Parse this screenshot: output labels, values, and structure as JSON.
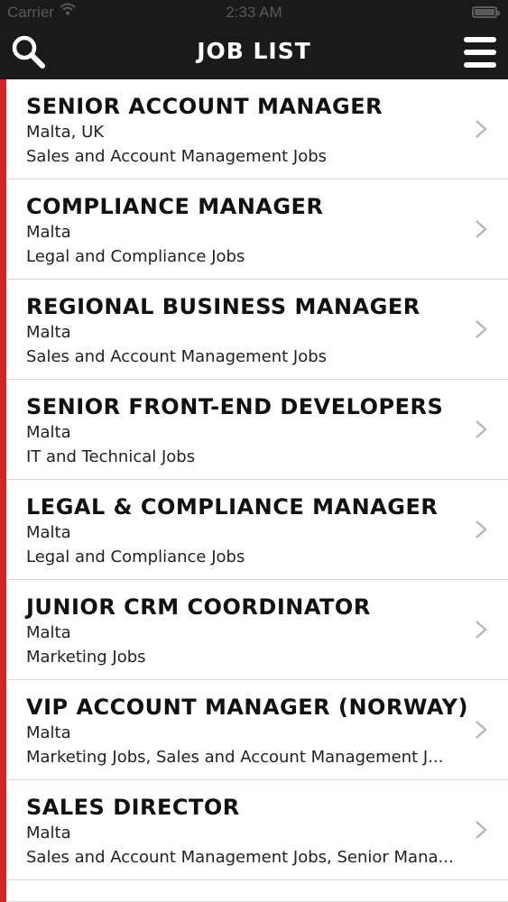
{
  "status_bar": {
    "carrier": "Carrier",
    "time": "2:33 AM"
  },
  "nav": {
    "title": "JOB LIST",
    "left_icon": "search-icon",
    "right_icon": "hamburger-menu-icon"
  },
  "jobs": [
    {
      "title": "SENIOR ACCOUNT MANAGER",
      "location": "Malta, UK",
      "category": "Sales and Account Management Jobs"
    },
    {
      "title": "COMPLIANCE MANAGER",
      "location": "Malta",
      "category": "Legal and Compliance Jobs"
    },
    {
      "title": "REGIONAL BUSINESS MANAGER",
      "location": "Malta",
      "category": "Sales and Account Management Jobs"
    },
    {
      "title": "SENIOR FRONT-END DEVELOPERS",
      "location": "Malta",
      "category": "IT and Technical Jobs"
    },
    {
      "title": "LEGAL & COMPLIANCE MANAGER",
      "location": "Malta",
      "category": "Legal and Compliance Jobs"
    },
    {
      "title": "JUNIOR CRM COORDINATOR",
      "location": "Malta",
      "category": "Marketing Jobs"
    },
    {
      "title": "VIP ACCOUNT MANAGER (NORWAY)",
      "location": "Malta",
      "category": "Marketing Jobs, Sales and Account Management J..."
    },
    {
      "title": "SALES DIRECTOR",
      "location": "Malta",
      "category": "Sales and Account Management Jobs, Senior Mana..."
    }
  ],
  "colors": {
    "header_bg": "#1a1a1a",
    "accent": "#d2232a",
    "chevron": "#b8b8b8"
  }
}
